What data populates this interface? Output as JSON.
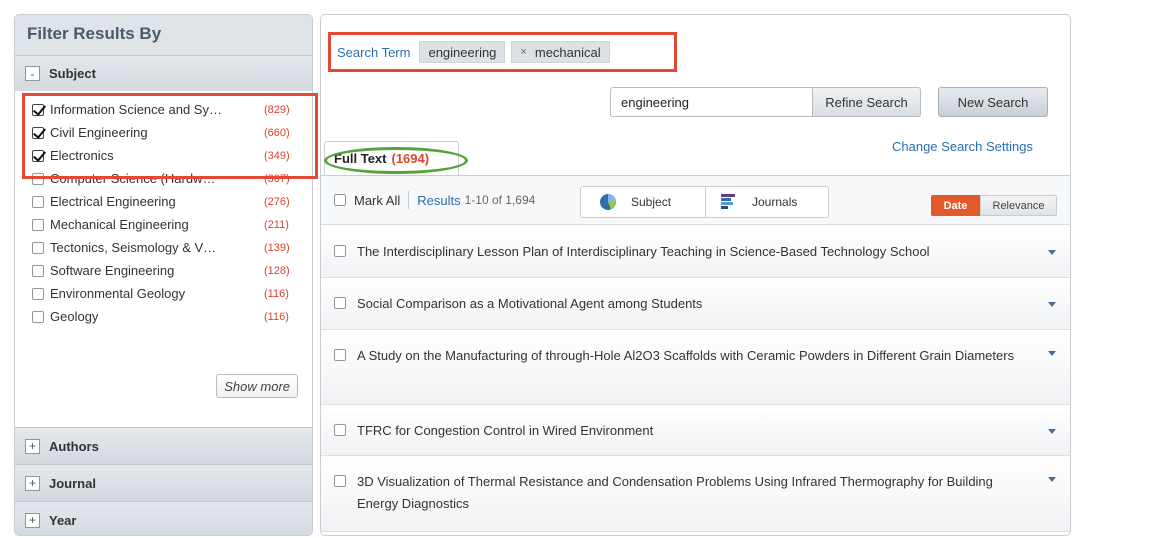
{
  "sidebar": {
    "title": "Filter Results By",
    "subject_section": {
      "label": "Subject",
      "toggle": "-"
    },
    "facets": [
      {
        "name": "Information Science and Sy…",
        "count": "(829)",
        "checked": true
      },
      {
        "name": "Civil Engineering",
        "count": "(660)",
        "checked": true
      },
      {
        "name": "Electronics",
        "count": "(349)",
        "checked": true
      },
      {
        "name": "Computer Science (Hardw…",
        "count": "(307)",
        "checked": false
      },
      {
        "name": "Electrical Engineering",
        "count": "(276)",
        "checked": false
      },
      {
        "name": "Mechanical Engineering",
        "count": "(211)",
        "checked": false
      },
      {
        "name": "Tectonics, Seismology & V…",
        "count": "(139)",
        "checked": false
      },
      {
        "name": "Software Engineering",
        "count": "(128)",
        "checked": false
      },
      {
        "name": "Environmental Geology",
        "count": "(116)",
        "checked": false
      },
      {
        "name": "Geology",
        "count": "(116)",
        "checked": false
      }
    ],
    "show_more": "Show more",
    "collapsed_sections": [
      {
        "label": "Authors",
        "toggle": "+"
      },
      {
        "label": "Journal",
        "toggle": "+"
      },
      {
        "label": "Year",
        "toggle": "+"
      }
    ]
  },
  "search": {
    "term_label": "Search Term",
    "terms": [
      {
        "text": "engineering",
        "removable": false
      },
      {
        "text": "mechanical",
        "removable": true,
        "remove_glyph": "×"
      }
    ],
    "refine_value": "engineering",
    "refine_button": "Refine Search",
    "new_search_button": "New Search",
    "change_settings": "Change Search Settings"
  },
  "tabs": {
    "full_text_label": "Full Text",
    "full_text_count": "(1694)"
  },
  "results_bar": {
    "mark_all": "Mark All",
    "results_word": "Results",
    "results_range": "1-10 of 1,694",
    "subject_view": "Subject",
    "journals_view": "Journals",
    "sort_date": "Date",
    "sort_relevance": "Relevance"
  },
  "results": [
    "The Interdisciplinary Lesson Plan of Interdisciplinary Teaching in Science-Based Technology School",
    "Social Comparison as a Motivational Agent among Students",
    "A Study on the Manufacturing of through-Hole Al2O3 Scaffolds with Ceramic Powders in Different Grain Diameters",
    "TFRC for Congestion Control in Wired Environment",
    "3D Visualization of Thermal Resistance and Condensation Problems Using Infrared Thermography for Building Energy Diagnostics"
  ],
  "colors": {
    "accent_link": "#2a6fb5",
    "count_red": "#d9442f",
    "highlight_red_box": "#e34a36",
    "highlight_green_oval": "#56a33a",
    "sort_active": "#e25a2b"
  }
}
